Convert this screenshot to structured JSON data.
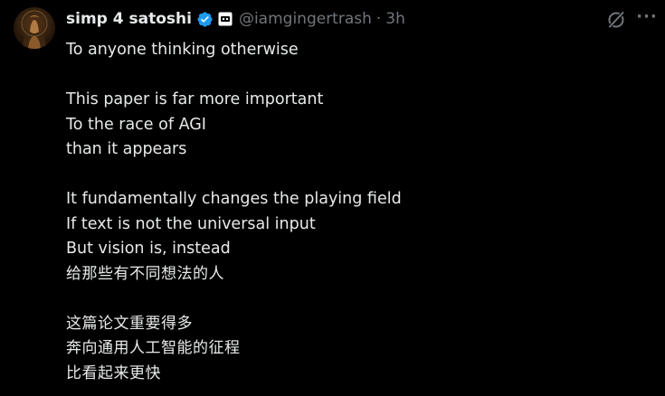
{
  "tweet": {
    "author": {
      "display_name": "simp 4 satoshi",
      "handle": "@iamgingertrash",
      "separator": "·",
      "time": "3h",
      "verified_color": "#1d9bf0",
      "avatar_icon": "portrait-avatar",
      "affiliation_icon": "affiliation-badge-icon"
    },
    "actions": {
      "grok_icon": "grok-icon",
      "more_label": "···"
    },
    "text": {
      "l1": "To anyone thinking otherwise",
      "l2": "",
      "l3": "This paper is far more important",
      "l4": "To the race of AGI",
      "l5": "than it appears",
      "l6": "",
      "l7": "It fundamentally changes the playing field",
      "l8": "If text is not the universal input",
      "l9": "But vision is, instead",
      "l10": "给那些有不同想法的人",
      "l11": "",
      "l12": "这篇论文重要得多",
      "l13": "奔向通用人工智能的征程",
      "l14": "比看起来更快"
    }
  },
  "theme": {
    "background": "#000000",
    "text": "#e7e9ea",
    "secondary": "#71767b",
    "accent": "#1d9bf0"
  }
}
